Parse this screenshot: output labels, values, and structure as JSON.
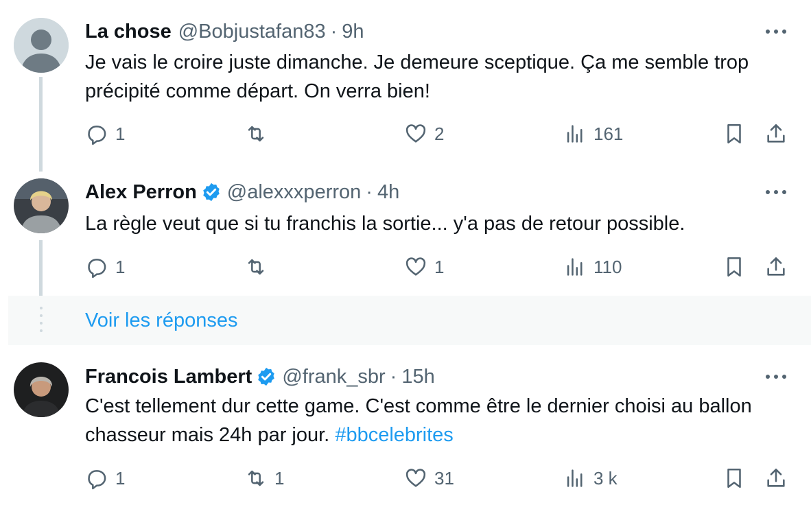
{
  "tweets": [
    {
      "name": "La chose",
      "handle": "@Bobjustafan83",
      "separator": "·",
      "time": "9h",
      "verified": false,
      "text": "Je vais le croire juste dimanche. Je demeure sceptique. Ça me semble trop précipité comme départ. On verra bien!",
      "hashtag": "",
      "replies": "1",
      "retweets": "",
      "likes": "2",
      "views": "161"
    },
    {
      "name": "Alex Perron",
      "handle": "@alexxxperron",
      "separator": "·",
      "time": "4h",
      "verified": true,
      "text": "La règle veut que si tu franchis la sortie... y'a pas de retour possible.",
      "hashtag": "",
      "replies": "1",
      "retweets": "",
      "likes": "1",
      "views": "110"
    },
    {
      "name": "Francois Lambert",
      "handle": "@frank_sbr",
      "separator": "·",
      "time": "15h",
      "verified": true,
      "text": "C'est tellement dur cette game. C'est comme être le dernier choisi au ballon chasseur mais 24h par jour. ",
      "hashtag": "#bbcelebrites",
      "replies": "1",
      "retweets": "1",
      "likes": "31",
      "views": "3 k"
    }
  ],
  "show_replies_label": "Voir les réponses",
  "colors": {
    "accent": "#1d9bf0",
    "muted": "#536471",
    "text": "#0f1419"
  },
  "icons": [
    "reply-icon",
    "retweet-icon",
    "like-icon",
    "views-icon",
    "bookmark-icon",
    "share-icon",
    "more-icon",
    "verified-badge-icon"
  ]
}
